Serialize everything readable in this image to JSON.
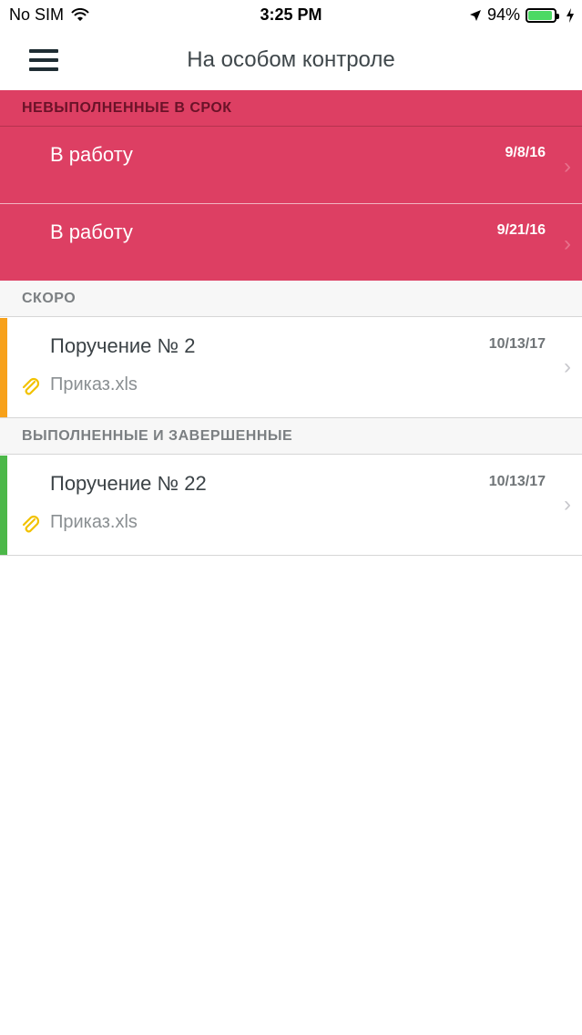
{
  "status_bar": {
    "carrier": "No SIM",
    "time": "3:25 PM",
    "battery_percent": "94%",
    "battery_level": 0.94,
    "icons": [
      "wifi-icon",
      "location-arrow-icon",
      "battery-icon",
      "charging-bolt-icon"
    ]
  },
  "nav": {
    "title": "На особом контроле",
    "menu_icon": "hamburger-menu-icon"
  },
  "sections": {
    "overdue": {
      "label": "НЕВЫПОЛНЕННЫЕ В СРОК",
      "items": [
        {
          "title": "В работу",
          "date": "9/8/16"
        },
        {
          "title": "В работу",
          "date": "9/21/16"
        }
      ]
    },
    "soon": {
      "label": "СКОРО",
      "items": [
        {
          "title": "Поручение № 2",
          "date": "10/13/17",
          "attachment": "Приказ.xls",
          "accent": "#f7a11a"
        }
      ]
    },
    "done": {
      "label": "ВЫПОЛНЕННЫЕ И ЗАВЕРШЕННЫЕ",
      "items": [
        {
          "title": "Поручение № 22",
          "date": "10/13/17",
          "attachment": "Приказ.xls",
          "accent": "#4cb849"
        }
      ]
    }
  },
  "colors": {
    "overdue_bg": "#dd3f63",
    "soon_accent": "#f7a11a",
    "done_accent": "#4cb849",
    "attachment_icon": "#f2c200"
  }
}
